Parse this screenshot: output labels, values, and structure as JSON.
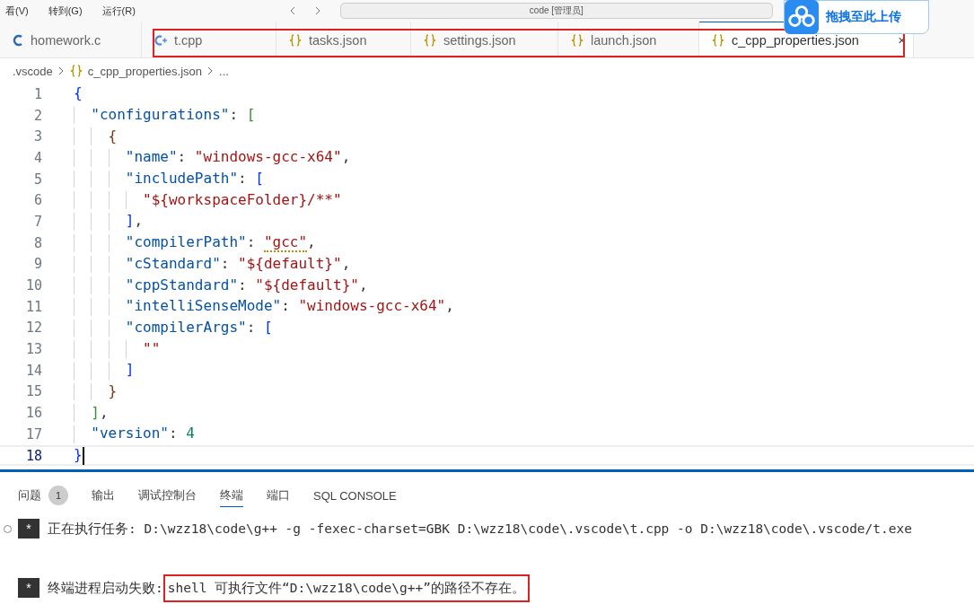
{
  "title_bar": {
    "menus": [
      "看(V)",
      "转到(G)",
      "运行(R)"
    ],
    "search": "code [管理员]"
  },
  "upload_badge": {
    "label": "拖拽至此上传"
  },
  "tabs": [
    {
      "label": "homework.c",
      "kind": "c",
      "selected": false,
      "highlighted": false
    },
    {
      "label": "t.cpp",
      "kind": "cpp",
      "selected": false,
      "highlighted": true
    },
    {
      "label": "tasks.json",
      "kind": "json",
      "selected": false,
      "highlighted": true
    },
    {
      "label": "settings.json",
      "kind": "json",
      "selected": false,
      "highlighted": true
    },
    {
      "label": "launch.json",
      "kind": "json",
      "selected": false,
      "highlighted": true
    },
    {
      "label": "c_cpp_properties.json",
      "kind": "json",
      "selected": true,
      "highlighted": true,
      "close": "×"
    }
  ],
  "breadcrumb": [
    {
      "label": ".vscode",
      "kind": "folder"
    },
    {
      "label": "c_cpp_properties.json",
      "kind": "json"
    },
    {
      "label": "...",
      "kind": "more"
    }
  ],
  "editor": {
    "lines": [
      {
        "number": "1",
        "current": false,
        "tokens": [
          {
            "kind": "b1",
            "text": "{"
          }
        ]
      },
      {
        "number": "2",
        "current": false,
        "tokens": [
          {
            "kind": "key",
            "text": "  \"configurations\""
          },
          {
            "kind": "punct",
            "text": ": "
          },
          {
            "kind": "b2",
            "text": "["
          }
        ]
      },
      {
        "number": "3",
        "current": false,
        "tokens": [
          {
            "kind": "b3",
            "text": "    {"
          }
        ]
      },
      {
        "number": "4",
        "current": false,
        "tokens": [
          {
            "kind": "key",
            "text": "      \"name\""
          },
          {
            "kind": "punct",
            "text": ": "
          },
          {
            "kind": "str",
            "text": "\"windows-gcc-x64\""
          },
          {
            "kind": "punct",
            "text": ","
          }
        ]
      },
      {
        "number": "5",
        "current": false,
        "tokens": [
          {
            "kind": "key",
            "text": "      \"includePath\""
          },
          {
            "kind": "punct",
            "text": ": "
          },
          {
            "kind": "b1",
            "text": "["
          }
        ]
      },
      {
        "number": "6",
        "current": false,
        "tokens": [
          {
            "kind": "str",
            "text": "        \"${workspaceFolder}/**\""
          }
        ]
      },
      {
        "number": "7",
        "current": false,
        "tokens": [
          {
            "kind": "b1",
            "text": "      ]"
          },
          {
            "kind": "punct",
            "text": ","
          }
        ]
      },
      {
        "number": "8",
        "current": false,
        "tokens": [
          {
            "kind": "key",
            "text": "      \"compilerPath\""
          },
          {
            "kind": "punct",
            "text": ": "
          },
          {
            "kind": "str",
            "text": "\"gcc\"",
            "warning": true
          },
          {
            "kind": "punct",
            "text": ","
          }
        ]
      },
      {
        "number": "9",
        "current": false,
        "tokens": [
          {
            "kind": "key",
            "text": "      \"cStandard\""
          },
          {
            "kind": "punct",
            "text": ": "
          },
          {
            "kind": "str",
            "text": "\"${default}\""
          },
          {
            "kind": "punct",
            "text": ","
          }
        ]
      },
      {
        "number": "10",
        "current": false,
        "tokens": [
          {
            "kind": "key",
            "text": "      \"cppStandard\""
          },
          {
            "kind": "punct",
            "text": ": "
          },
          {
            "kind": "str",
            "text": "\"${default}\""
          },
          {
            "kind": "punct",
            "text": ","
          }
        ]
      },
      {
        "number": "11",
        "current": false,
        "tokens": [
          {
            "kind": "key",
            "text": "      \"intelliSenseMode\""
          },
          {
            "kind": "punct",
            "text": ": "
          },
          {
            "kind": "str",
            "text": "\"windows-gcc-x64\""
          },
          {
            "kind": "punct",
            "text": ","
          }
        ]
      },
      {
        "number": "12",
        "current": false,
        "tokens": [
          {
            "kind": "key",
            "text": "      \"compilerArgs\""
          },
          {
            "kind": "punct",
            "text": ": "
          },
          {
            "kind": "b1",
            "text": "["
          }
        ]
      },
      {
        "number": "13",
        "current": false,
        "tokens": [
          {
            "kind": "str",
            "text": "        \"\""
          }
        ]
      },
      {
        "number": "14",
        "current": false,
        "tokens": [
          {
            "kind": "b1",
            "text": "      ]"
          }
        ]
      },
      {
        "number": "15",
        "current": false,
        "tokens": [
          {
            "kind": "b3",
            "text": "    }"
          }
        ]
      },
      {
        "number": "16",
        "current": false,
        "tokens": [
          {
            "kind": "b2",
            "text": "  ]"
          },
          {
            "kind": "punct",
            "text": ","
          }
        ]
      },
      {
        "number": "17",
        "current": false,
        "tokens": [
          {
            "kind": "key",
            "text": "  \"version\""
          },
          {
            "kind": "punct",
            "text": ": "
          },
          {
            "kind": "num",
            "text": "4"
          }
        ]
      },
      {
        "number": "18",
        "current": true,
        "tokens": [
          {
            "kind": "b1",
            "text": "}"
          }
        ]
      }
    ]
  },
  "panel": {
    "tabs": [
      {
        "label": "问题",
        "badge": "1",
        "selected": false
      },
      {
        "label": "输出",
        "selected": false
      },
      {
        "label": "调试控制台",
        "selected": false
      },
      {
        "label": "终端",
        "selected": true
      },
      {
        "label": "端口",
        "selected": false
      },
      {
        "label": "SQL CONSOLE",
        "selected": false
      }
    ],
    "terminal": [
      {
        "marker": "*",
        "prefix": "正在执行任务: D:\\wzz18\\code\\g++ -g -fexec-charset=GBK D:\\wzz18\\code\\.vscode\\t.cpp -o D:\\wzz18\\code\\.vscode/t.exe",
        "circle": true
      },
      {
        "marker": "*",
        "prefix": "终端进程启动失败:",
        "highlight": "shell 可执行文件“D:\\wzz18\\code\\g++”的路径不存在。",
        "circle": false
      }
    ]
  }
}
